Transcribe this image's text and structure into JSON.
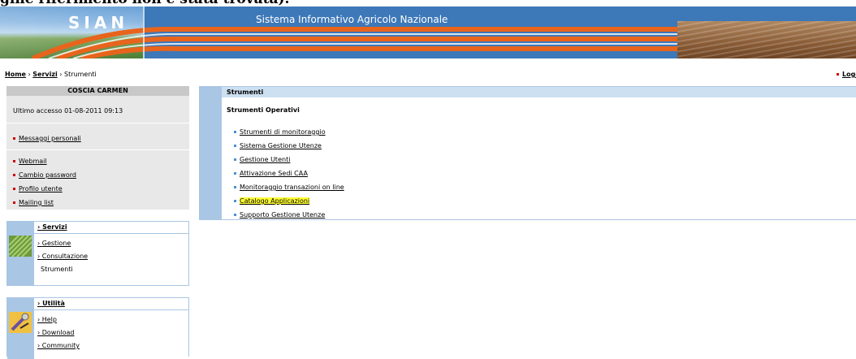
{
  "page": {
    "clipped_heading": "gine riferimento non è stata trovata)."
  },
  "banner": {
    "logo": "SIAN",
    "title": "Sistema Informativo Agricolo Nazionale"
  },
  "breadcrumb": {
    "home": "Home",
    "sep1": " › ",
    "servizi": "Servizi",
    "sep2": " › ",
    "current": "Strumenti"
  },
  "logout": "Logout",
  "user": {
    "name": "COSCIA CARMEN",
    "last_access": "Ultimo accesso 01-08-2011 09:13",
    "messages": "Messaggi personali",
    "links": [
      "Webmail",
      "Cambio password",
      "Profilo utente",
      "Mailing list"
    ]
  },
  "servizi": {
    "title": "› Servizi",
    "items": [
      "› Gestione",
      "› Consultazione",
      "Strumenti"
    ]
  },
  "utilita": {
    "title": "› Utilità",
    "items": [
      "› Help",
      "› Download",
      "› Community"
    ]
  },
  "main": {
    "header": "Strumenti",
    "subtitle": "Strumenti Operativi",
    "links": [
      "Strumenti di monitoraggio",
      "Sistema Gestione Utenze",
      "Gestione Utenti",
      "Attivazione Sedi CAA",
      "Monitoraggio transazioni on line",
      "Catalogo Applicazioni",
      "Supporto Gestione Utenze"
    ]
  },
  "colors": {
    "banner_blue": "#3d78b8",
    "stripe_orange": "#e8641c",
    "panel_blue": "#a9c6e4",
    "highlight": "#ffff33"
  },
  "icons": [
    "field-image-icon",
    "tools-image-icon"
  ]
}
